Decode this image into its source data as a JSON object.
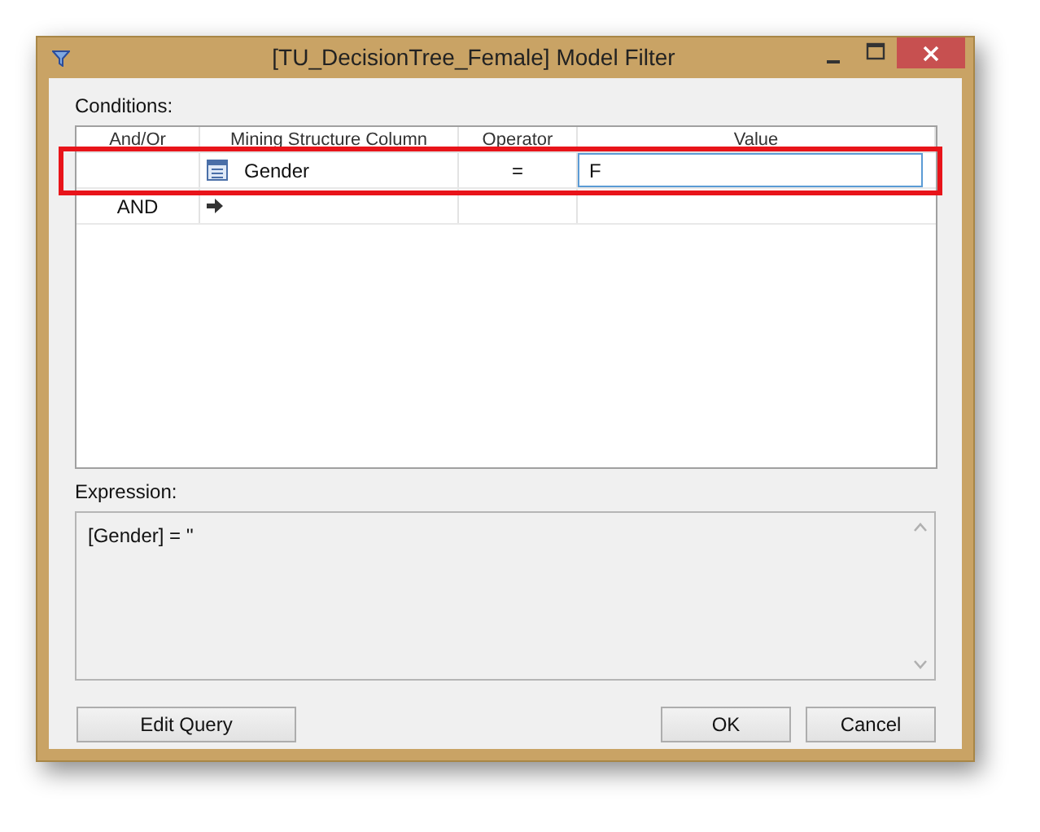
{
  "window": {
    "title": "[TU_DecisionTree_Female] Model Filter"
  },
  "conditions": {
    "label": "Conditions:",
    "columns": [
      "And/Or",
      "Mining Structure Column",
      "Operator",
      "Value"
    ],
    "rows": [
      {
        "kind": "condition",
        "column": "Gender",
        "operator": "=",
        "value": "F",
        "highlighted": true
      },
      {
        "kind": "new",
        "and_or": "AND",
        "highlighted": false
      }
    ]
  },
  "expression": {
    "label": "Expression:",
    "text": "[Gender] = ''"
  },
  "buttons": {
    "edit_query": "Edit Query",
    "ok": "OK",
    "cancel": "Cancel"
  }
}
